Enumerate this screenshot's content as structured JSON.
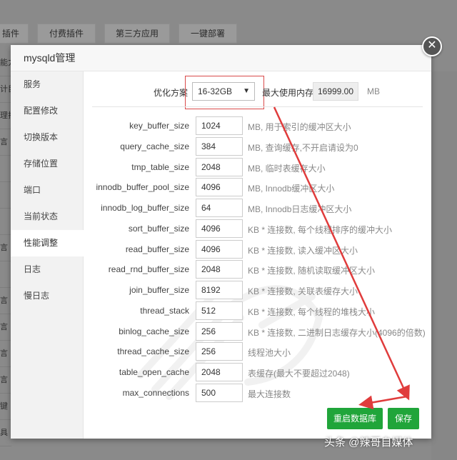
{
  "background": {
    "tabs": [
      "插件",
      "付费插件",
      "第三方应用",
      "一键部署"
    ],
    "left_fragments": [
      "能力",
      "计目",
      "理排",
      "言",
      "",
      "",
      "",
      "言",
      "",
      "言",
      "言",
      "言",
      "言",
      "键",
      "具"
    ]
  },
  "dialog": {
    "title": "mysqld管理",
    "close_icon": "close-icon"
  },
  "nav": {
    "items": [
      "服务",
      "配置修改",
      "切换版本",
      "存储位置",
      "端口",
      "当前状态",
      "性能调整",
      "日志",
      "慢日志"
    ],
    "active": "性能调整"
  },
  "tuning": {
    "scheme_label": "优化方案",
    "scheme_value": "16-32GB",
    "max_mem_label": "最大使用内存",
    "max_mem_value": "16999.00",
    "max_mem_unit": "MB",
    "params": [
      {
        "name": "key_buffer_size",
        "value": "1024",
        "desc": "MB, 用于索引的缓冲区大小"
      },
      {
        "name": "query_cache_size",
        "value": "384",
        "desc": "MB, 查询缓存,不开启请设为0"
      },
      {
        "name": "tmp_table_size",
        "value": "2048",
        "desc": "MB, 临时表缓存大小"
      },
      {
        "name": "innodb_buffer_pool_size",
        "value": "4096",
        "desc": "MB, Innodb缓冲区大小"
      },
      {
        "name": "innodb_log_buffer_size",
        "value": "64",
        "desc": "MB, Innodb日志缓冲区大小"
      },
      {
        "name": "sort_buffer_size",
        "value": "4096",
        "desc": "KB * 连接数, 每个线程排序的缓冲大小"
      },
      {
        "name": "read_buffer_size",
        "value": "4096",
        "desc": "KB * 连接数, 读入缓冲区大小"
      },
      {
        "name": "read_rnd_buffer_size",
        "value": "2048",
        "desc": "KB * 连接数, 随机读取缓冲区大小"
      },
      {
        "name": "join_buffer_size",
        "value": "8192",
        "desc": "KB * 连接数, 关联表缓存大小"
      },
      {
        "name": "thread_stack",
        "value": "512",
        "desc": "KB * 连接数, 每个线程的堆栈大小"
      },
      {
        "name": "binlog_cache_size",
        "value": "256",
        "desc": "KB * 连接数, 二进制日志缓存大小(4096的倍数)"
      },
      {
        "name": "thread_cache_size",
        "value": "256",
        "desc": "线程池大小"
      },
      {
        "name": "table_open_cache",
        "value": "2048",
        "desc": "表缓存(最大不要超过2048)"
      },
      {
        "name": "max_connections",
        "value": "500",
        "desc": "最大连接数"
      }
    ],
    "restart_label": "重启数据库",
    "save_label": "保存"
  },
  "watermark": "头条 @辣哥自媒体",
  "colors": {
    "accent_green": "#20a53a",
    "highlight_red": "#d94a4a",
    "overlay": "#8a8a8a"
  }
}
